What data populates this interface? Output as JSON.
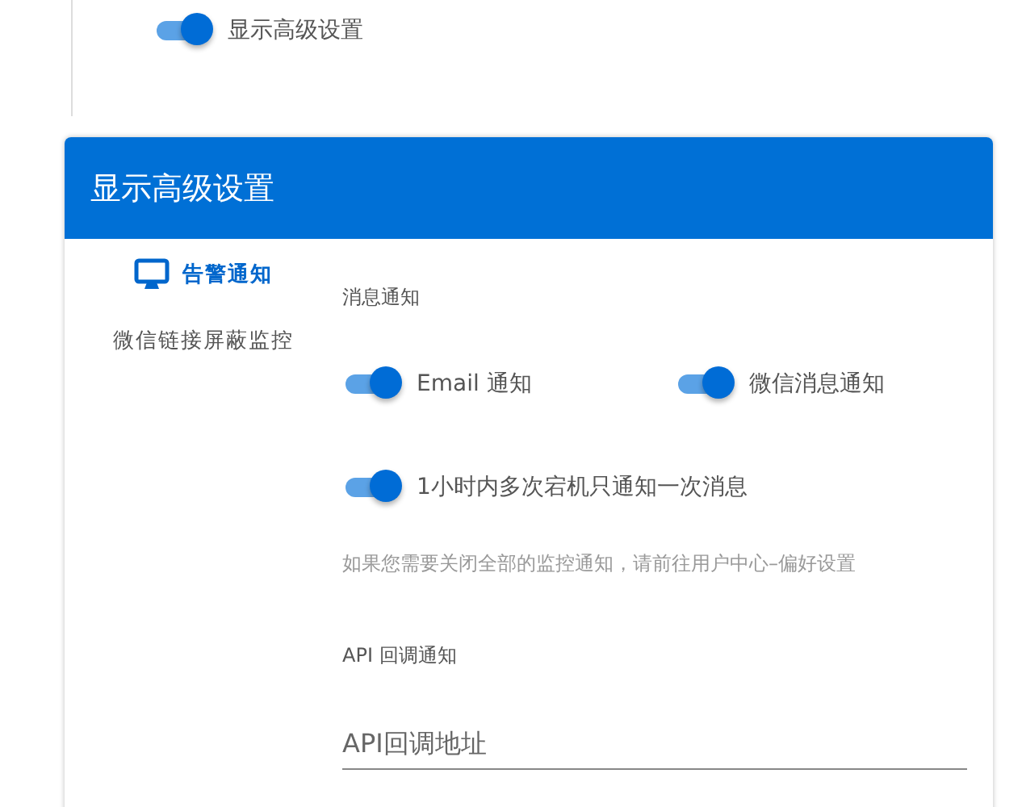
{
  "advanced_toggle": {
    "label": "显示高级设置",
    "on": true
  },
  "dialog": {
    "title": "显示高级设置",
    "sidebar": {
      "items": [
        {
          "label": "告警通知",
          "selected": true
        },
        {
          "label": "微信链接屏蔽监控",
          "selected": false
        }
      ]
    },
    "message_section": {
      "title": "消息通知",
      "toggles": [
        {
          "label": "Email 通知",
          "on": true
        },
        {
          "label": "微信消息通知",
          "on": true
        },
        {
          "label": "1小时内多次宕机只通知一次消息",
          "on": true
        }
      ],
      "hint": "如果您需要关闭全部的监控通知，请前往用户中心–偏好设置"
    },
    "api_section": {
      "title": "API 回调通知",
      "field": {
        "placeholder": "API回调地址"
      }
    }
  }
}
